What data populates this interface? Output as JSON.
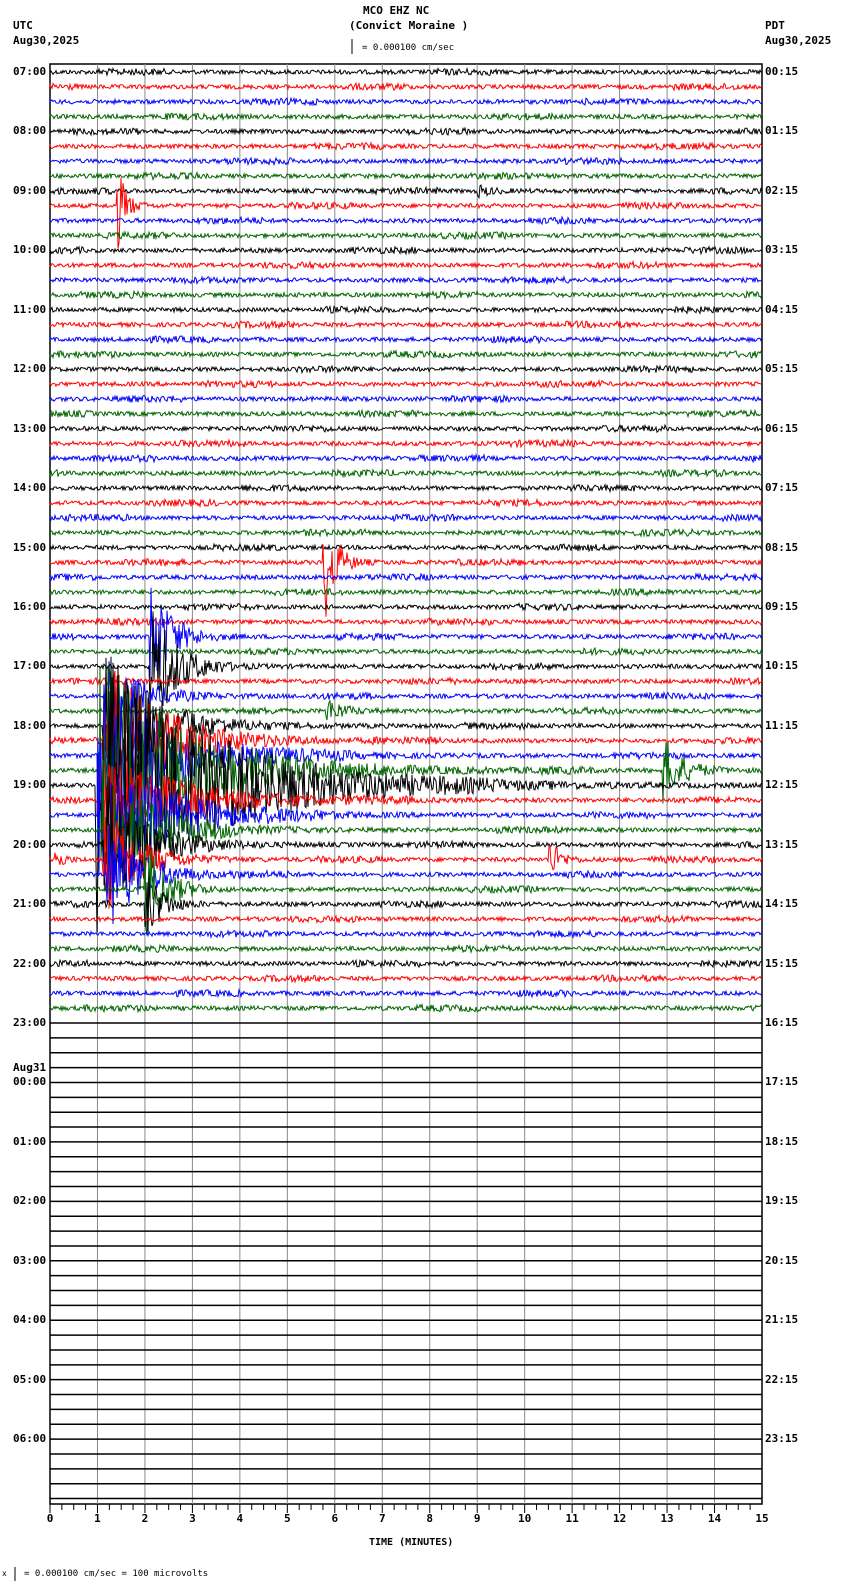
{
  "header": {
    "station": "MCO EHZ NC",
    "site": "(Convict Moraine )",
    "scale": "= 0.000100 cm/sec",
    "left_tz": "UTC",
    "left_date": "Aug30,2025",
    "right_tz": "PDT",
    "right_date": "Aug30,2025"
  },
  "footer": {
    "scale_note": "= 0.000100 cm/sec =     100 microvolts",
    "scale_mark": "x"
  },
  "chart_data": {
    "type": "line",
    "title": "MCO EHZ NC (Convict Moraine )",
    "xlabel": "TIME (MINUTES)",
    "xlim": [
      0,
      15
    ],
    "xticks": [
      "0",
      "1",
      "2",
      "3",
      "4",
      "5",
      "6",
      "7",
      "8",
      "9",
      "10",
      "11",
      "12",
      "13",
      "14",
      "15"
    ],
    "traces_per_hour": 4,
    "total_lines": 97,
    "recorded_lines": 64,
    "trace_colors": [
      "#000000",
      "#ff0000",
      "#0000ff",
      "#006400"
    ],
    "utc_labels": [
      "07:00",
      "08:00",
      "09:00",
      "10:00",
      "11:00",
      "12:00",
      "13:00",
      "14:00",
      "15:00",
      "16:00",
      "17:00",
      "18:00",
      "19:00",
      "20:00",
      "21:00",
      "22:00",
      "23:00",
      "00:00",
      "01:00",
      "02:00",
      "03:00",
      "04:00",
      "05:00",
      "06:00"
    ],
    "utc_date_change": {
      "label": "Aug31",
      "before": "00:00"
    },
    "pdt_labels": [
      "00:15",
      "01:15",
      "02:15",
      "03:15",
      "04:15",
      "05:15",
      "06:15",
      "07:15",
      "08:15",
      "09:15",
      "10:15",
      "11:15",
      "12:15",
      "13:15",
      "14:15",
      "15:15",
      "16:15",
      "17:15",
      "18:15",
      "19:15",
      "20:15",
      "21:15",
      "22:15",
      "23:15"
    ],
    "events": [
      {
        "trace": 9,
        "minute": 1.4,
        "amp": 50,
        "dur": 0.5
      },
      {
        "trace": 8,
        "minute": 9.0,
        "amp": 6,
        "dur": 0.8
      },
      {
        "trace": 33,
        "minute": 5.75,
        "amp": 70,
        "dur": 0.7
      },
      {
        "trace": 43,
        "minute": 5.8,
        "amp": 14,
        "dur": 1.0
      },
      {
        "trace": 44,
        "minute": 1.1,
        "amp": 80,
        "dur": 3.0
      },
      {
        "trace": 45,
        "minute": 1.1,
        "amp": 90,
        "dur": 3.5
      },
      {
        "trace": 46,
        "minute": 1.0,
        "amp": 100,
        "dur": 4.0
      },
      {
        "trace": 47,
        "minute": 1.0,
        "amp": 120,
        "dur": 5.5
      },
      {
        "trace": 48,
        "minute": 0.95,
        "amp": 150,
        "dur": 7.0
      },
      {
        "trace": 49,
        "minute": 1.0,
        "amp": 60,
        "dur": 4.5
      },
      {
        "trace": 50,
        "minute": 1.0,
        "amp": 80,
        "dur": 4.0
      },
      {
        "trace": 51,
        "minute": 1.1,
        "amp": 70,
        "dur": 3.0
      },
      {
        "trace": 52,
        "minute": 1.1,
        "amp": 80,
        "dur": 2.5
      },
      {
        "trace": 53,
        "minute": 1.1,
        "amp": 60,
        "dur": 2.0
      },
      {
        "trace": 54,
        "minute": 1.2,
        "amp": 60,
        "dur": 2.0
      },
      {
        "trace": 55,
        "minute": 2.0,
        "amp": 50,
        "dur": 1.2
      },
      {
        "trace": 56,
        "minute": 2.0,
        "amp": 40,
        "dur": 1.0
      },
      {
        "trace": 38,
        "minute": 2.1,
        "amp": 70,
        "dur": 1.2
      },
      {
        "trace": 40,
        "minute": 2.1,
        "amp": 70,
        "dur": 1.5
      },
      {
        "trace": 42,
        "minute": 1.2,
        "amp": 40,
        "dur": 2.0
      },
      {
        "trace": 47,
        "minute": 12.9,
        "amp": 35,
        "dur": 1.2
      },
      {
        "trace": 53,
        "minute": 10.5,
        "amp": 25,
        "dur": 0.6
      },
      {
        "trace": 53,
        "minute": 0.1,
        "amp": 12,
        "dur": 0.5
      }
    ]
  }
}
